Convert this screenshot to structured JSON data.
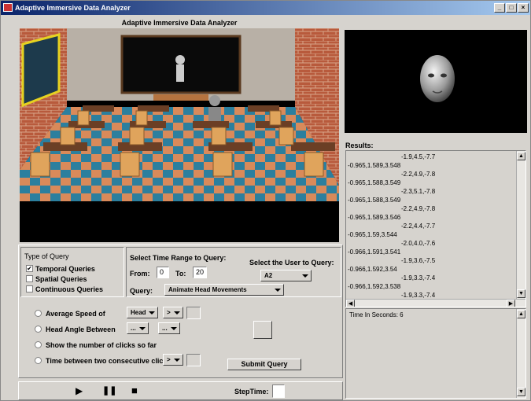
{
  "window": {
    "title": "Adaptive Immersive Data Analyzer",
    "min_label": "_",
    "max_label": "□",
    "close_label": "×"
  },
  "scene": {
    "title": "Adaptive Immersive Data Analyzer"
  },
  "results": {
    "label": "Results:",
    "lines": [
      "-1.9,4.5,-7.7",
      "-0.965,1.589,3.548",
      "-2.2,4.9,-7.8",
      "-0.965,1.588,3.549",
      "-2.3,5.1,-7.8",
      "-0.965,1.588,3.549",
      "-2.2,4.9,-7.8",
      "-0.965,1.589,3.546",
      "-2.2,4.4,-7.7",
      "-0.965,1.59,3.544",
      "-2.0,4.0,-7.6",
      "-0.966,1.591,3.541",
      "-1.9,3.6,-7.5",
      "-0.966,1.592,3.54",
      "-1.9,3.3,-7.4",
      "-0.966,1.592,3.538",
      "-1.9,3.3,-7.4"
    ],
    "time_text": "Time In Seconds: 6"
  },
  "query_type": {
    "header": "Type of Query",
    "options": [
      {
        "label": "Temporal Queries",
        "checked": true
      },
      {
        "label": "Spatial Queries",
        "checked": false
      },
      {
        "label": "Continuous Queries",
        "checked": false
      }
    ]
  },
  "time_range": {
    "header": "Select Time Range to Query:",
    "from_label": "From:",
    "from_value": "0",
    "to_label": "To:",
    "to_value": "20",
    "user_label": "Select the User to Query:",
    "user_value": "A2",
    "query_label": "Query:",
    "query_value": "Animate Head Movements"
  },
  "query_options": {
    "avg_speed_label": "Average Speed of",
    "avg_speed_part": "Head",
    "avg_speed_op": ">",
    "head_angle_label": "Head Angle Between",
    "head_angle_a": "...",
    "head_angle_b": "...",
    "clicks_label": "Show the number of clicks so far",
    "time_between_label": "Time between two consecutive clicks",
    "time_between_op": ">",
    "submit_label": "Submit Query"
  },
  "playback": {
    "play_glyph": "▶",
    "pause_glyph": "❚❚",
    "stop_glyph": "■",
    "steptime_label": "StepTime:",
    "steptime_value": ""
  }
}
